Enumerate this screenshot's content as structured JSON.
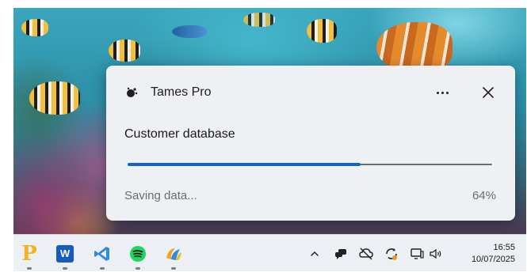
{
  "notification": {
    "app_name": "Tames Pro",
    "title": "Customer database",
    "status": "Saving data...",
    "percent_label": "64%",
    "progress": 0.64,
    "accent_color": "#1565c0",
    "icons": {
      "app": "tames-pro-logo-icon",
      "more": "more-options-icon",
      "close": "close-icon"
    }
  },
  "taskbar": {
    "pinned_apps": [
      {
        "name": "parking-app-icon",
        "letter": "P",
        "color": "#f2b41e"
      },
      {
        "name": "word-icon",
        "letter": "W",
        "color": "#185abd"
      },
      {
        "name": "vscode-icon",
        "color": "#2f8ae0"
      },
      {
        "name": "spotify-icon",
        "color": "#1ed760"
      },
      {
        "name": "photos-app-icon",
        "color": "#f2a21e"
      }
    ],
    "tray": [
      "chevron-up-icon",
      "chat-icon",
      "cloud-off-icon",
      "sync-icon",
      "network-icon",
      "volume-icon"
    ],
    "time": "16:55",
    "date": "10/07/2025"
  }
}
